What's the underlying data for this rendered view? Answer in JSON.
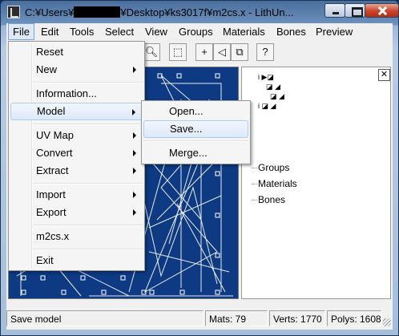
{
  "window": {
    "title_prefix": "C:¥Users¥",
    "title_suffix": "¥Desktop¥ks3017f¥m2cs.x - LithUn..."
  },
  "menubar": [
    "File",
    "Edit",
    "Tools",
    "Select",
    "View",
    "Groups",
    "Materials",
    "Bones",
    "Preview"
  ],
  "file_menu": {
    "items": [
      {
        "label": "Reset",
        "submenu": false
      },
      {
        "label": "New",
        "submenu": true
      },
      {
        "label": "Information...",
        "submenu": false
      },
      {
        "label": "Model",
        "submenu": true,
        "highlighted": true
      },
      {
        "label": "UV Map",
        "submenu": true
      },
      {
        "label": "Convert",
        "submenu": true
      },
      {
        "label": "Extract",
        "submenu": true
      },
      {
        "label": "Import",
        "submenu": true
      },
      {
        "label": "Export",
        "submenu": true
      },
      {
        "label": "m2cs.x",
        "submenu": false
      },
      {
        "label": "Exit",
        "submenu": false
      }
    ]
  },
  "model_submenu": {
    "items": [
      {
        "label": "Open..."
      },
      {
        "label": "Save...",
        "highlighted": true
      },
      {
        "label": "Merge..."
      }
    ]
  },
  "tree": [
    "Groups",
    "Materials",
    "Bones"
  ],
  "panel_close": "✕",
  "status": {
    "message": "Save model",
    "mats": "Mats: 79",
    "verts": "Verts: 1770",
    "polys": "Polys: 1608"
  },
  "colors": {
    "viewport_bg": "#0d3a82",
    "highlight": "#dde9f7"
  }
}
